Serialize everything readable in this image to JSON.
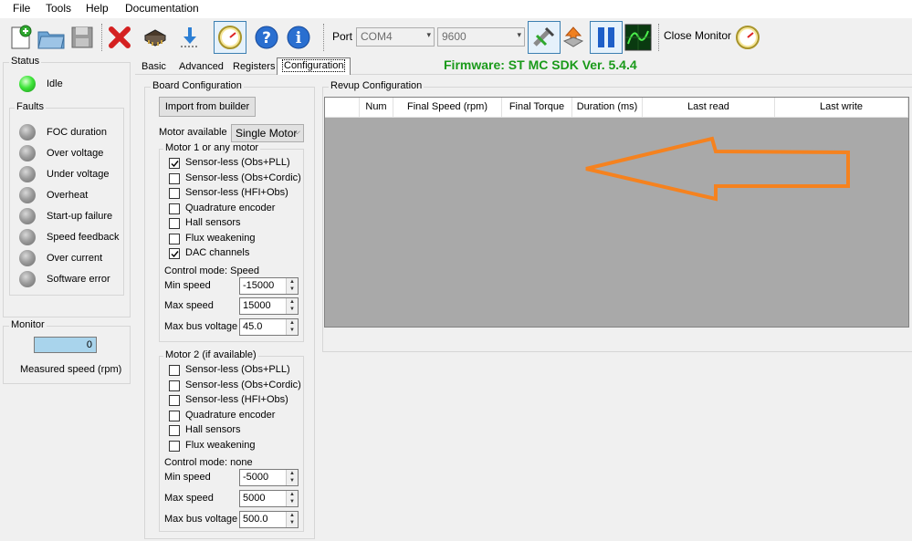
{
  "menu": [
    "File",
    "Tools",
    "Help",
    "Documentation"
  ],
  "toolbar": {
    "port_label": "Port",
    "port_value": "COM4",
    "baud_value": "9600",
    "close_monitor_label": "Close Monitor"
  },
  "status": {
    "title": "Status",
    "state": "Idle",
    "faults_title": "Faults",
    "faults": [
      "FOC duration",
      "Over voltage",
      "Under voltage",
      "Overheat",
      "Start-up failure",
      "Speed feedback",
      "Over current",
      "Software error"
    ]
  },
  "monitor": {
    "title": "Monitor",
    "value": "0",
    "caption": "Measured speed (rpm)"
  },
  "tabs": [
    "Basic",
    "Advanced",
    "Registers",
    "Configuration"
  ],
  "firmware": "Firmware: ST MC SDK Ver. 5.4.4",
  "board": {
    "title": "Board Configuration",
    "import_button": "Import from builder",
    "motor_available_label": "Motor available",
    "motor_available_value": "Single Motor",
    "motor1": {
      "title": "Motor 1 or any motor",
      "options": [
        {
          "label": "Sensor-less (Obs+PLL)",
          "checked": true
        },
        {
          "label": "Sensor-less (Obs+Cordic)",
          "checked": false
        },
        {
          "label": "Sensor-less (HFI+Obs)",
          "checked": false
        },
        {
          "label": "Quadrature encoder",
          "checked": false
        },
        {
          "label": "Hall sensors",
          "checked": false
        },
        {
          "label": "Flux weakening",
          "checked": false
        },
        {
          "label": "DAC channels",
          "checked": true
        }
      ],
      "control_mode": "Control mode: Speed",
      "min_speed_label": "Min speed",
      "min_speed": "-15000",
      "max_speed_label": "Max speed",
      "max_speed": "15000",
      "max_bus_label": "Max bus voltage",
      "max_bus": "45.0"
    },
    "motor2": {
      "title": "Motor 2 (if available)",
      "options": [
        {
          "label": "Sensor-less (Obs+PLL)",
          "checked": false
        },
        {
          "label": "Sensor-less (Obs+Cordic)",
          "checked": false
        },
        {
          "label": "Sensor-less (HFI+Obs)",
          "checked": false
        },
        {
          "label": "Quadrature encoder",
          "checked": false
        },
        {
          "label": "Hall sensors",
          "checked": false
        },
        {
          "label": "Flux weakening",
          "checked": false
        }
      ],
      "control_mode": "Control mode: none",
      "min_speed_label": "Min speed",
      "min_speed": "-5000",
      "max_speed_label": "Max speed",
      "max_speed": "5000",
      "max_bus_label": "Max bus voltage",
      "max_bus": "500.0"
    }
  },
  "revup": {
    "title": "Revup Configuration",
    "columns": [
      "",
      "Num",
      "Final Speed (rpm)",
      "Final Torque",
      "Duration (ms)",
      "Last read",
      "Last write"
    ]
  },
  "colors": {
    "firmware_text": "#1a9a1a",
    "annotation_arrow": "#f5821f",
    "table_bg": "#a9a9a9"
  },
  "icons": [
    "new-file-icon",
    "open-folder-icon",
    "save-icon",
    "delete-icon",
    "chip-icon",
    "download-icon",
    "gauge-icon",
    "help-icon",
    "info-icon",
    "connect-plug-icon",
    "upload-icon",
    "pause-icon",
    "oscilloscope-icon",
    "gauge-icon"
  ]
}
